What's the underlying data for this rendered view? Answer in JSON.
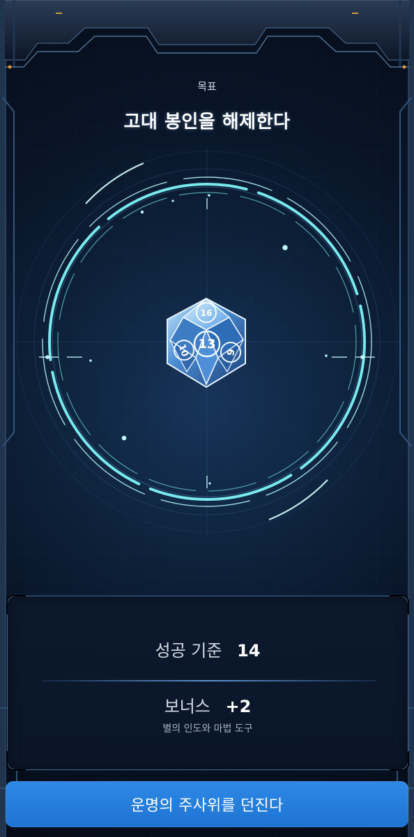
{
  "header": {
    "objective_label": "목표",
    "objective_title": "고대 봉인을 해제한다"
  },
  "dice": {
    "faces": [
      "16",
      "13",
      "10",
      "9"
    ]
  },
  "panel": {
    "success_label": "성공 기준",
    "success_value": "14",
    "bonus_label": "보너스",
    "bonus_value": "+2",
    "bonus_source": "별의 인도와 마법 도구"
  },
  "action": {
    "button_label": "운명의 주사위를 던진다"
  },
  "colors": {
    "primary_button": "#1e73d1",
    "ring_glow": "#7ff3f7",
    "corner_accent": "#d09b3c"
  },
  "icons": {
    "dice": "d20-dice-icon"
  }
}
